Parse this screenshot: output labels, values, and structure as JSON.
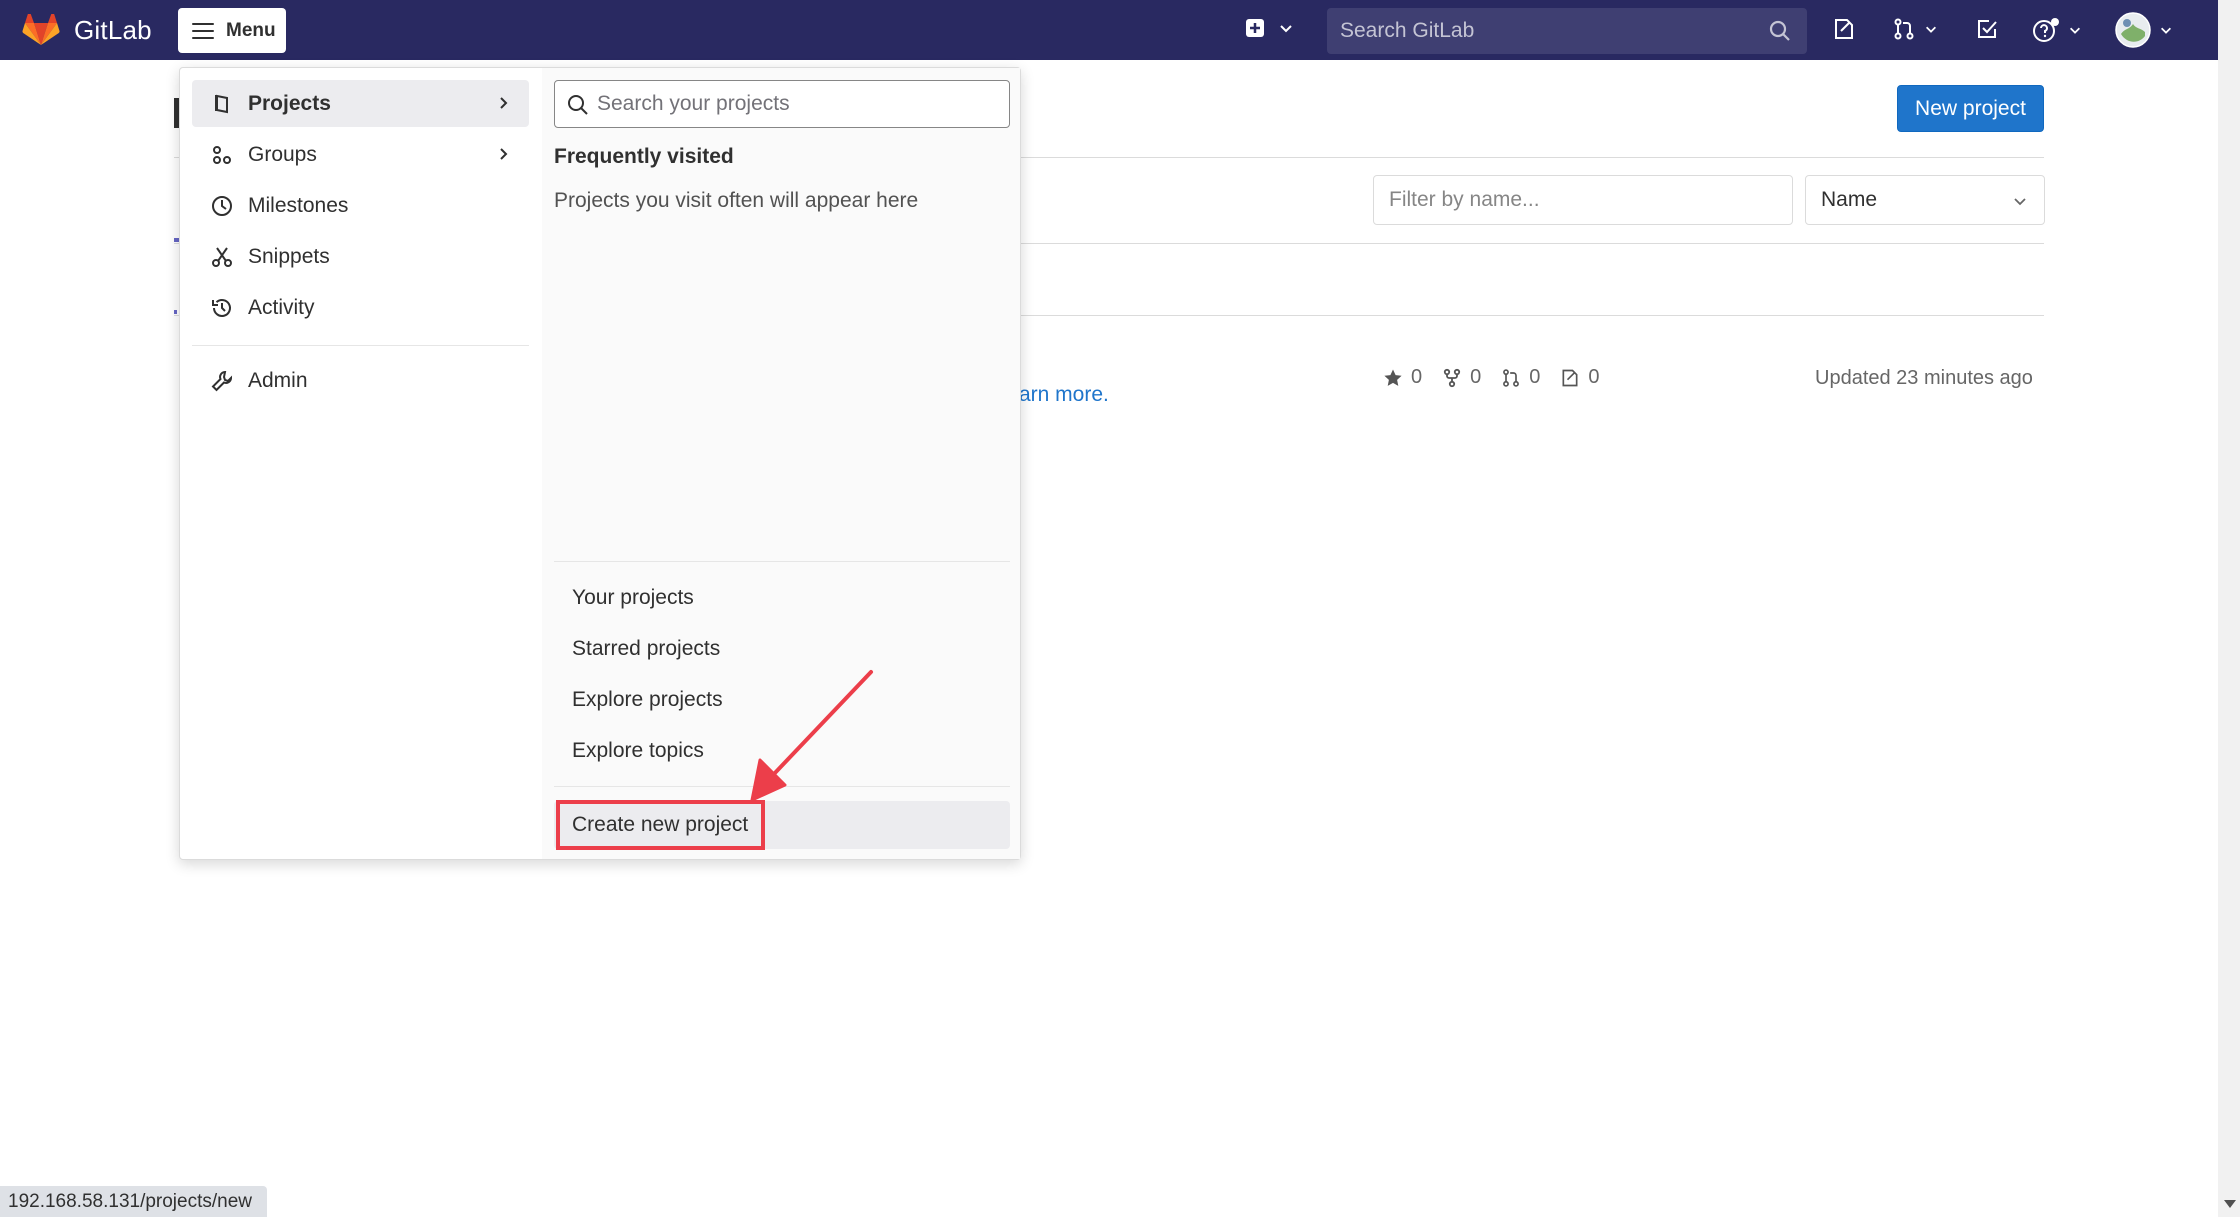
{
  "app": {
    "name": "GitLab"
  },
  "topbar": {
    "menu_label": "Menu",
    "search_placeholder": "Search GitLab"
  },
  "page": {
    "new_project_button": "New project",
    "filter_placeholder": "Filter by name...",
    "sort_selected": "Name",
    "learn_more_fragment": "arn more.",
    "project_stats": {
      "stars": "0",
      "forks": "0",
      "merge_requests": "0",
      "issues": "0"
    },
    "updated_text": "Updated 23 minutes ago"
  },
  "menu": {
    "left_items": [
      {
        "label": "Projects",
        "icon": "project-icon",
        "has_submenu": true,
        "active": true
      },
      {
        "label": "Groups",
        "icon": "group-icon",
        "has_submenu": true,
        "active": false
      },
      {
        "label": "Milestones",
        "icon": "clock-icon",
        "has_submenu": false,
        "active": false
      },
      {
        "label": "Snippets",
        "icon": "scissors-icon",
        "has_submenu": false,
        "active": false
      },
      {
        "label": "Activity",
        "icon": "history-icon",
        "has_submenu": false,
        "active": false
      }
    ],
    "admin_item": {
      "label": "Admin",
      "icon": "wrench-icon"
    },
    "projects_panel": {
      "search_placeholder": "Search your projects",
      "frequent_title": "Frequently visited",
      "frequent_empty": "Projects you visit often will appear here",
      "links": [
        "Your projects",
        "Starred projects",
        "Explore projects",
        "Explore topics"
      ],
      "create_label": "Create new project"
    }
  },
  "status_url": "192.168.58.131/projects/new",
  "colors": {
    "topbar": "#292961",
    "primary_button": "#1f75cb",
    "annotation": "#ec3e4a",
    "logo_orange": "#fc6d26",
    "logo_red": "#e24329"
  }
}
